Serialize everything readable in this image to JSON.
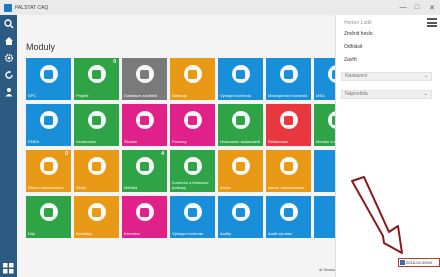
{
  "titlebar": {
    "title": "PALSTAT CAQ",
    "min": "—",
    "max": "□",
    "close": "✕"
  },
  "main": {
    "title": "Moduly"
  },
  "tiles": [
    {
      "label": "SPC",
      "color": "#1a8fd9",
      "badge": "",
      "icon": "chart"
    },
    {
      "label": "Projekt",
      "color": "#2ea447",
      "badge": "0",
      "icon": "list"
    },
    {
      "label": "Databáze zdvatelů",
      "color": "#7a7a7a",
      "badge": "",
      "icon": "db"
    },
    {
      "label": "Nástroje",
      "color": "#e89a16",
      "badge": "",
      "icon": "tools"
    },
    {
      "label": "Výstupní kontrola",
      "color": "#1a8fd9",
      "badge": "",
      "icon": "check"
    },
    {
      "label": "Mezioperační kontrola",
      "color": "#1a8fd9",
      "badge": "",
      "icon": "flow"
    },
    {
      "label": "MSA",
      "color": "#1a8fd9",
      "badge": "",
      "icon": "gauge"
    },
    {
      "label": "FMEA",
      "color": "#1a8fd9",
      "badge": "",
      "icon": "fmea"
    },
    {
      "label": "Vzorkování",
      "color": "#2ea447",
      "badge": "",
      "icon": "cycle"
    },
    {
      "label": "Školení",
      "color": "#e0218a",
      "badge": "",
      "icon": "person"
    },
    {
      "label": "Procesy",
      "color": "#e0218a",
      "badge": "",
      "icon": "process"
    },
    {
      "label": "Hodnocení dodavatelů",
      "color": "#2ea447",
      "badge": "",
      "icon": "rating"
    },
    {
      "label": "Reklamace",
      "color": "#e8373e",
      "badge": "",
      "icon": "claim"
    },
    {
      "label": "Monitor a zaměření",
      "color": "#2ea447",
      "badge": "",
      "icon": "monitor"
    },
    {
      "label": "Řízení dokumentací",
      "color": "#e89a16",
      "badge": "0",
      "icon": "docs"
    },
    {
      "label": "Stroje",
      "color": "#e89a16",
      "badge": "",
      "icon": "machine"
    },
    {
      "label": "Měřidla",
      "color": "#2ea447",
      "badge": "4",
      "icon": "meter"
    },
    {
      "label": "Kontrolní a testovací postupy",
      "color": "#2ea447",
      "badge": "",
      "icon": "test"
    },
    {
      "label": "Archiv",
      "color": "#e89a16",
      "badge": "",
      "icon": "archive"
    },
    {
      "label": "Interní dokumentace",
      "color": "#e89a16",
      "badge": "",
      "icon": "idocs"
    },
    {
      "label": "",
      "color": "#1a8fd9",
      "badge": "",
      "icon": "blank"
    },
    {
      "label": "Díly",
      "color": "#2ea447",
      "badge": "",
      "icon": "parts"
    },
    {
      "label": "Kontakty",
      "color": "#e89a16",
      "badge": "",
      "icon": "contacts"
    },
    {
      "label": "Interview",
      "color": "#e0218a",
      "badge": "",
      "icon": "interview"
    },
    {
      "label": "Výstupní kontrola",
      "color": "#1a8fd9",
      "badge": "",
      "icon": "check"
    },
    {
      "label": "Audity",
      "color": "#1a8fd9",
      "badge": "",
      "icon": "audit"
    },
    {
      "label": "Audit výrobku",
      "color": "#1a8fd9",
      "badge": "",
      "icon": "audit2"
    },
    {
      "label": "",
      "color": "#1a8fd9",
      "badge": "",
      "icon": "blank"
    }
  ],
  "bottom_text": "al Sestavy,Fabily 08(PALS",
  "rpanel": {
    "user": "Herber Ludě",
    "menu": [
      "Změnit heslo",
      "Odhlásit",
      "Zavřít"
    ],
    "sections": [
      "Nastavení",
      "Nápověda"
    ],
    "chevron": "⌄"
  },
  "datebox": {
    "text": "2018-02-09/04"
  },
  "colors": {
    "arrow": "#8b1a1a",
    "sidebar": "#2b5b83"
  }
}
